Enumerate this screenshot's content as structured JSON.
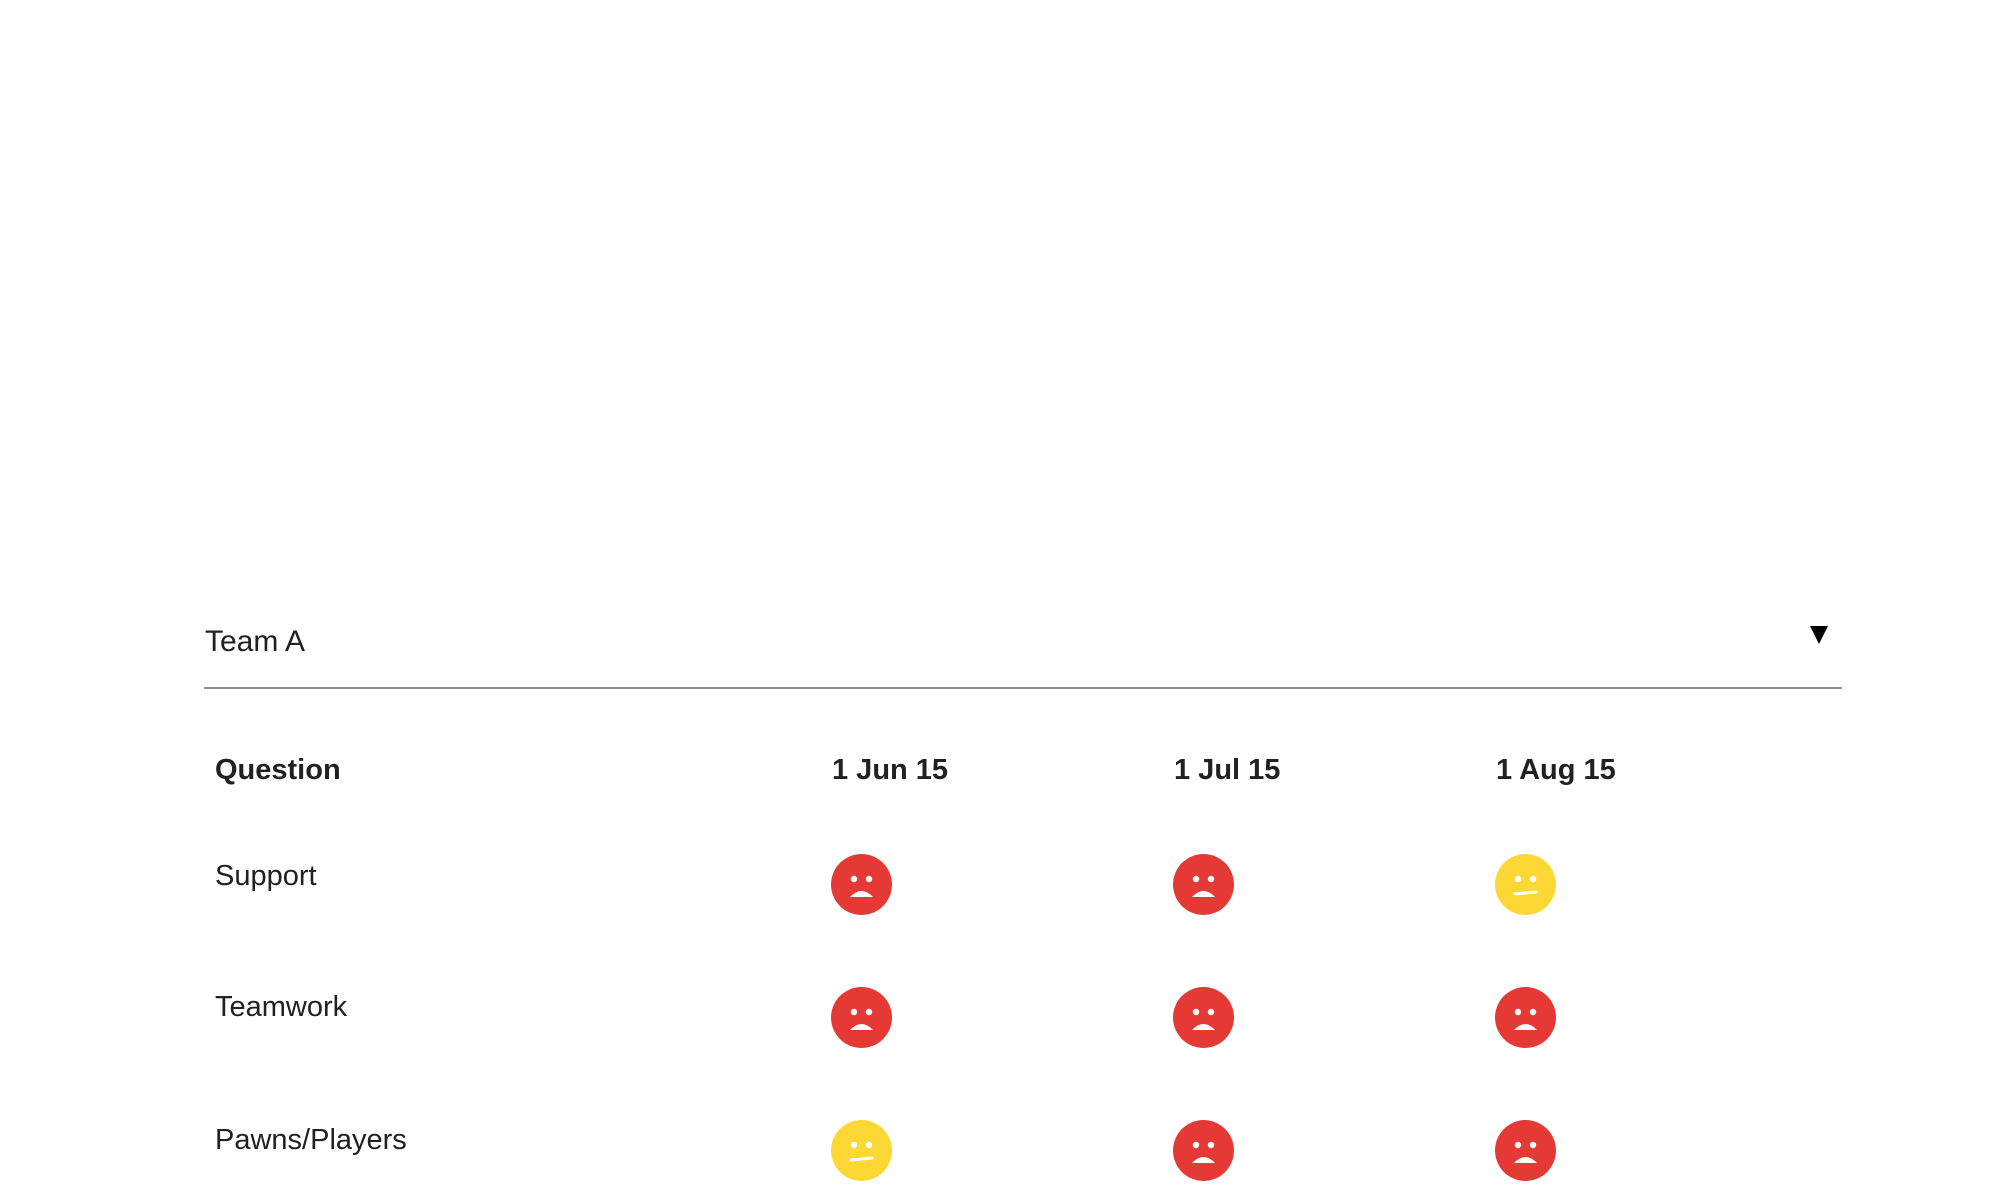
{
  "team_select": {
    "value": "Team A",
    "icon": "dropdown-triangle-icon"
  },
  "table": {
    "headers": {
      "question": "Question",
      "dates": [
        "1 Jun 15",
        "1 Jul 15",
        "1 Aug 15"
      ]
    },
    "rows": [
      {
        "question": "Support",
        "moods": [
          "sad",
          "sad",
          "neutral"
        ]
      },
      {
        "question": "Teamwork",
        "moods": [
          "sad",
          "sad",
          "sad"
        ]
      },
      {
        "question": "Pawns/Players",
        "moods": [
          "neutral",
          "sad",
          "sad"
        ]
      }
    ]
  },
  "colors": {
    "sad": "#e53935",
    "neutral": "#fdd835",
    "text": "#212121",
    "divider": "#8c8c8c"
  }
}
